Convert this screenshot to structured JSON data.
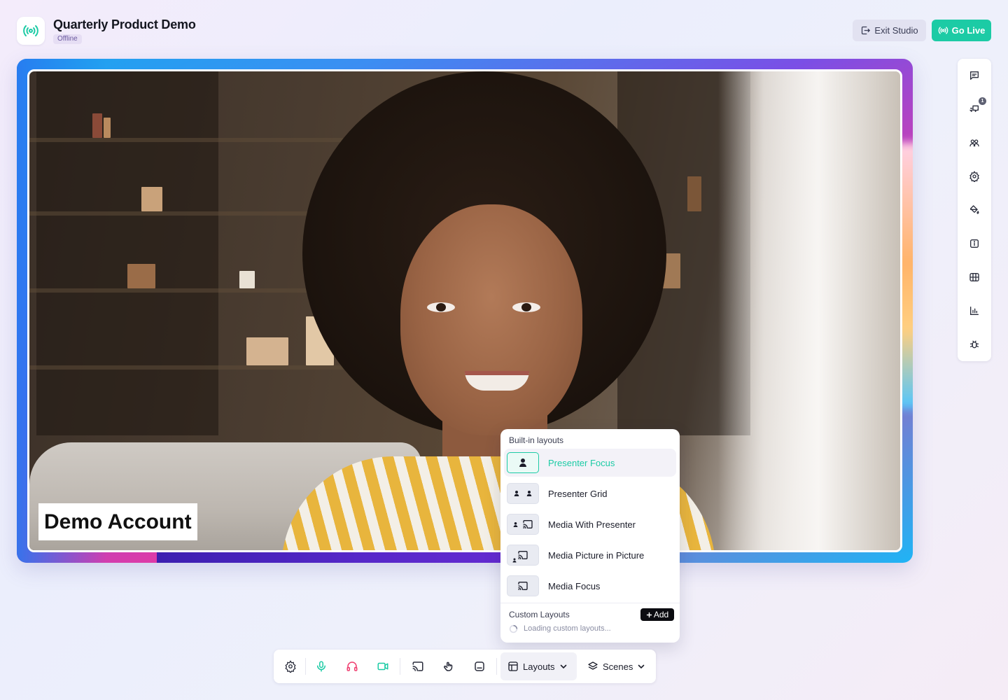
{
  "header": {
    "title": "Quarterly Product Demo",
    "status": "Offline",
    "exit_label": "Exit Studio",
    "golive_label": "Go Live"
  },
  "stage": {
    "presenter_name": "Demo Account"
  },
  "sidebar": {
    "items": [
      {
        "name": "chat-icon"
      },
      {
        "name": "comments-icon",
        "badge": "1"
      },
      {
        "name": "participants-icon"
      },
      {
        "name": "settings-icon"
      },
      {
        "name": "paint-bucket-icon"
      },
      {
        "name": "info-icon"
      },
      {
        "name": "media-icon"
      },
      {
        "name": "analytics-icon"
      },
      {
        "name": "bug-icon"
      }
    ]
  },
  "layouts_menu": {
    "builtin_heading": "Built-in layouts",
    "items": [
      {
        "label": "Presenter Focus",
        "active": true
      },
      {
        "label": "Presenter Grid",
        "active": false
      },
      {
        "label": "Media With Presenter",
        "active": false
      },
      {
        "label": "Media Picture in Picture",
        "active": false
      },
      {
        "label": "Media Focus",
        "active": false
      }
    ],
    "custom_heading": "Custom Layouts",
    "add_label": "Add",
    "loading_text": "Loading custom layouts..."
  },
  "toolbar": {
    "layouts_label": "Layouts",
    "scenes_label": "Scenes"
  },
  "colors": {
    "accent": "#1ccba5",
    "danger": "#ef3f70",
    "text": "#1b1d2a"
  }
}
